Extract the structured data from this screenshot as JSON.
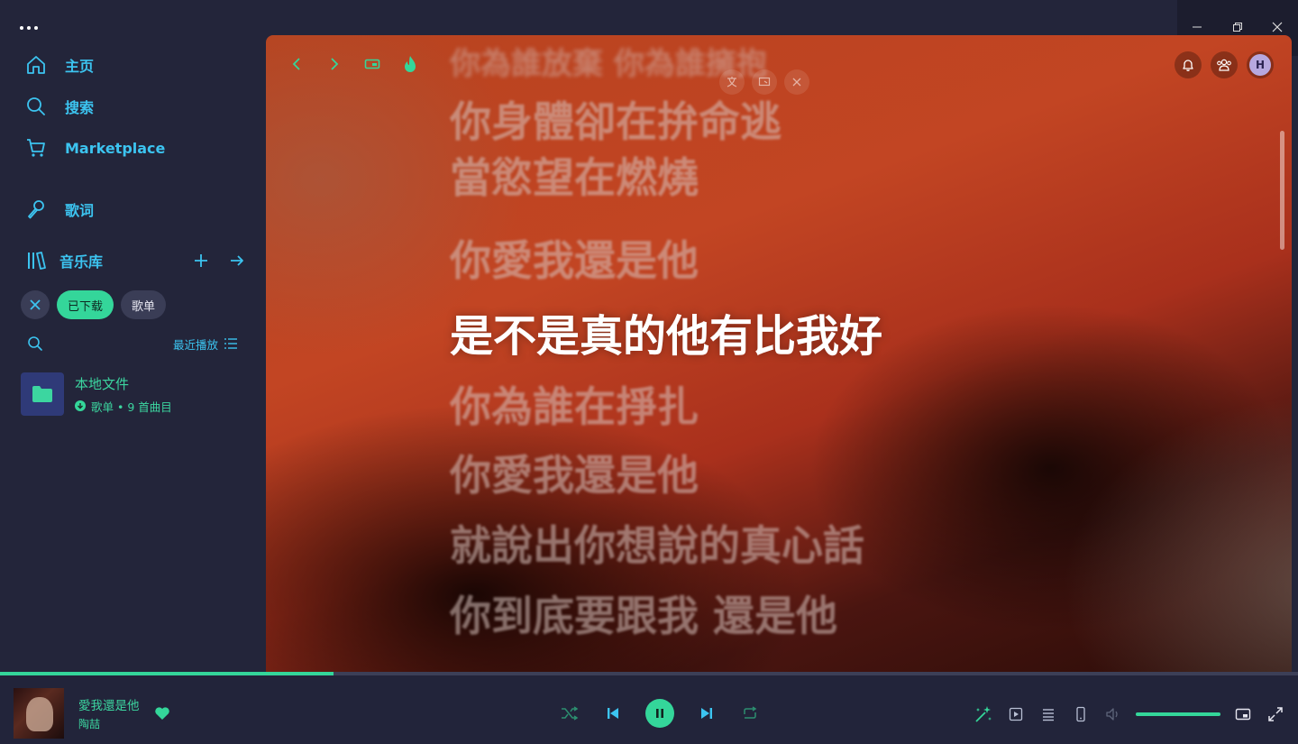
{
  "sidebar": {
    "nav": [
      {
        "label": "主页",
        "icon": "home-icon"
      },
      {
        "label": "搜索",
        "icon": "search-icon"
      },
      {
        "label": "Marketplace",
        "icon": "cart-icon"
      },
      {
        "label": "歌词",
        "icon": "microphone-icon"
      }
    ],
    "library": {
      "label": "音乐库"
    },
    "filters": [
      {
        "label": "已下载",
        "active": true
      },
      {
        "label": "歌单",
        "active": false
      }
    ],
    "sort_label": "最近播放",
    "entries": [
      {
        "title": "本地文件",
        "subtitle": "歌单 • 9 首曲目"
      }
    ]
  },
  "profile": {
    "initial": "H"
  },
  "lyrics": {
    "lines": [
      {
        "text": "你為誰放棄 你為誰擁抱",
        "state": "past-cut"
      },
      {
        "text": "你身體卻在拚命逃",
        "state": "past"
      },
      {
        "text": "當慾望在燃燒",
        "state": "past"
      },
      {
        "text": "你愛我還是他",
        "state": "past"
      },
      {
        "text": "是不是真的他有比我好",
        "state": "current"
      },
      {
        "text": "你為誰在掙扎",
        "state": "future"
      },
      {
        "text": "你愛我還是他",
        "state": "future"
      },
      {
        "text": "就說出你想說的真心話",
        "state": "future"
      },
      {
        "text": "你到底要跟我  還是他",
        "state": "future"
      }
    ]
  },
  "player": {
    "track_title": "愛我還是他",
    "artist": "陶喆",
    "progress_fraction": 0.257,
    "volume_fraction": 1.0,
    "liked": true
  },
  "colors": {
    "accent": "#34d69a",
    "link_blue": "#3cc4f0",
    "sidebar_bg": "#23253a",
    "player_bg": "#22243a"
  }
}
